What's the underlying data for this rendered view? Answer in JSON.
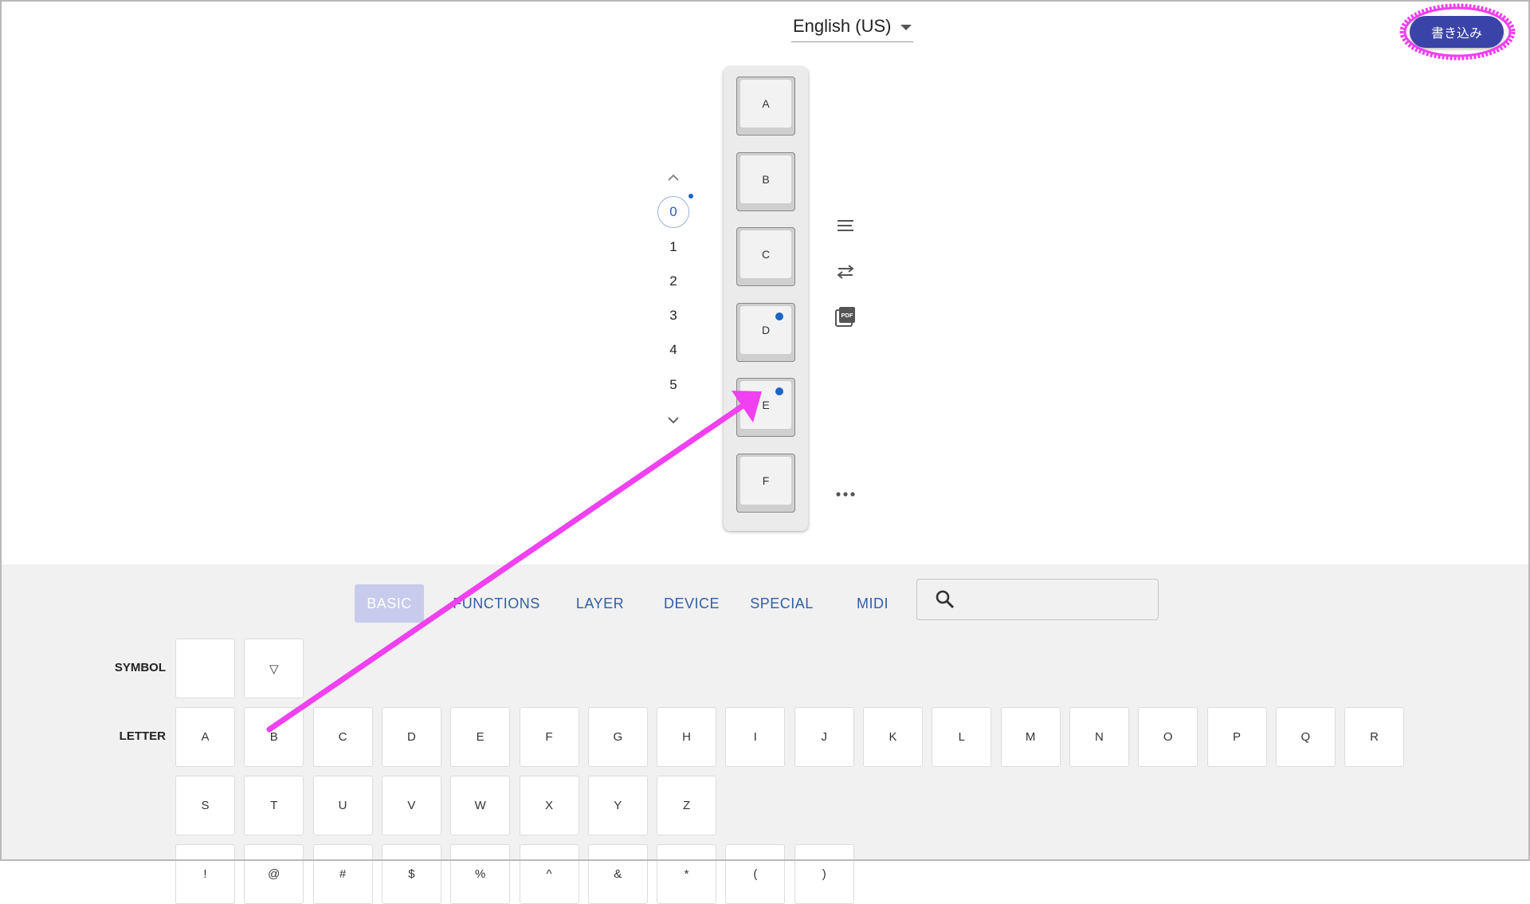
{
  "header": {
    "language": "English (US)",
    "write_button": "書き込み"
  },
  "layers": {
    "items": [
      "0",
      "1",
      "2",
      "3",
      "4",
      "5"
    ],
    "active_index": 0
  },
  "keyboard": {
    "keys": [
      {
        "label": "A",
        "has_dot": false
      },
      {
        "label": "B",
        "has_dot": false
      },
      {
        "label": "C",
        "has_dot": false
      },
      {
        "label": "D",
        "has_dot": true
      },
      {
        "label": "E",
        "has_dot": true
      },
      {
        "label": "F",
        "has_dot": false
      }
    ]
  },
  "side_tools": [
    "menu-lines-icon",
    "swap-arrows-icon",
    "pdf-icon",
    "more-dots-icon"
  ],
  "palette": {
    "tabs": [
      "BASIC",
      "FUNCTIONS",
      "LAYER",
      "DEVICE",
      "SPECIAL",
      "MIDI"
    ],
    "active_tab": "BASIC",
    "search": {
      "value": "",
      "placeholder": ""
    },
    "symbol_label": "SYMBOL",
    "symbol_keys": [
      "",
      "▽"
    ],
    "letter_label": "LETTER",
    "letter_row1": [
      "A",
      "B",
      "C",
      "D",
      "E",
      "F",
      "G",
      "H",
      "I",
      "J",
      "K",
      "L",
      "M",
      "N",
      "O",
      "P",
      "Q",
      "R"
    ],
    "letter_row2": [
      "S",
      "T",
      "U",
      "V",
      "W",
      "X",
      "Y",
      "Z"
    ],
    "symbol_row_partial": [
      "!",
      "@",
      "#",
      "$",
      "%",
      "^",
      "&",
      "*",
      "(",
      ")"
    ]
  },
  "colors": {
    "primary_button": "#3a44a8",
    "active_tab_bg": "#c7cbec",
    "tab_text": "#2f5fa5",
    "dot": "#1e63c6",
    "annotation": "#f040f0"
  }
}
